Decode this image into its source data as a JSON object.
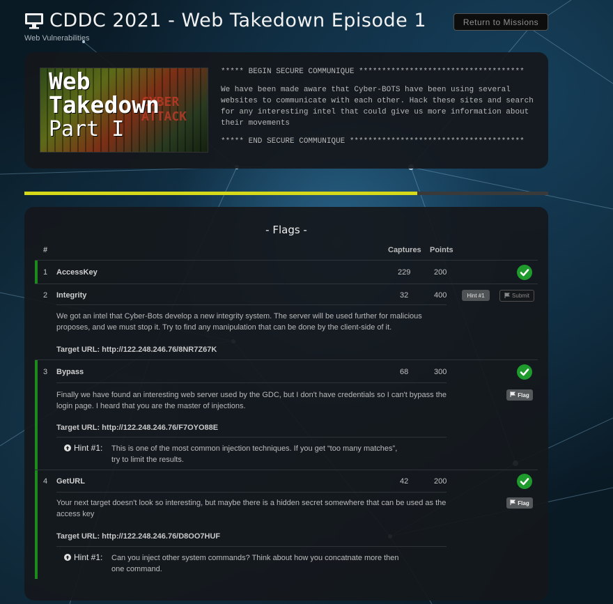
{
  "header": {
    "title": "CDDC 2021 - Web Takedown Episode 1",
    "subtitle": "Web Vulnerabilities",
    "return_label": "Return to Missions"
  },
  "intro": {
    "banner_line1": "Web",
    "banner_line2": "Takedown",
    "banner_line3": "Part I",
    "banner_mark": "CYBER ATTACK",
    "begin": "***** BEGIN SECURE COMMUNIQUE ************************************",
    "body": "We have been made aware that Cyber-BOTS have been using several websites to communicate with each other. Hack these sites and search for any interesting intel that could give us more information about their movements",
    "end": "***** END SECURE COMMUNIQUE **************************************"
  },
  "progress": {
    "fraction": 0.75,
    "fill_color": "#d6d91a"
  },
  "flags": {
    "title": "- Flags -",
    "headers": {
      "num": "#",
      "captures": "Captures",
      "points": "Points"
    },
    "rows": [
      {
        "num": "1",
        "name": "AccessKey",
        "captures": "229",
        "points": "200",
        "solved": true
      },
      {
        "num": "2",
        "name": "Integrity",
        "captures": "32",
        "points": "400",
        "solved": false,
        "desc": "We got an  intel that Cyber-Bots develop a new integrity system. The server will be used further for malicious proposes, and we must stop it. Try to find any manipulation that can be done by the client-side of it.",
        "target": "Target URL: http://122.248.246.76/8NR7Z67K",
        "hint_button": "Hint #1",
        "submit_button": "Submit"
      },
      {
        "num": "3",
        "name": "Bypass",
        "captures": "68",
        "points": "300",
        "solved": true,
        "desc": "Finally we have found an interesting web server used by the GDC, but I don't have credentials so I can't bypass the login page. I heard that you are the master of injections.",
        "target": "Target URL: http://122.248.246.76/F7OYO88E",
        "hint_label": "Hint #1:",
        "hint_text": "This is one of the most common injection techniques. If you get “too many matches”, try to limit the results.",
        "flag_button": "Flag"
      },
      {
        "num": "4",
        "name": "GetURL",
        "captures": "42",
        "points": "200",
        "solved": true,
        "desc": "Your next target doesn't look so interesting, but maybe there is a hidden secret somewhere that can be used as the access key",
        "target": "Target URL: http://122.248.246.76/D8OO7HUF",
        "hint_label": "Hint #1:",
        "hint_text": "Can you inject other system commands? Think about how you  concatnate more then one command.",
        "flag_button": "Flag"
      }
    ]
  },
  "colors": {
    "solved_stripe": "#1d8a1d",
    "check": "#1f9a2c",
    "accent_progress": "#d6d91a"
  }
}
